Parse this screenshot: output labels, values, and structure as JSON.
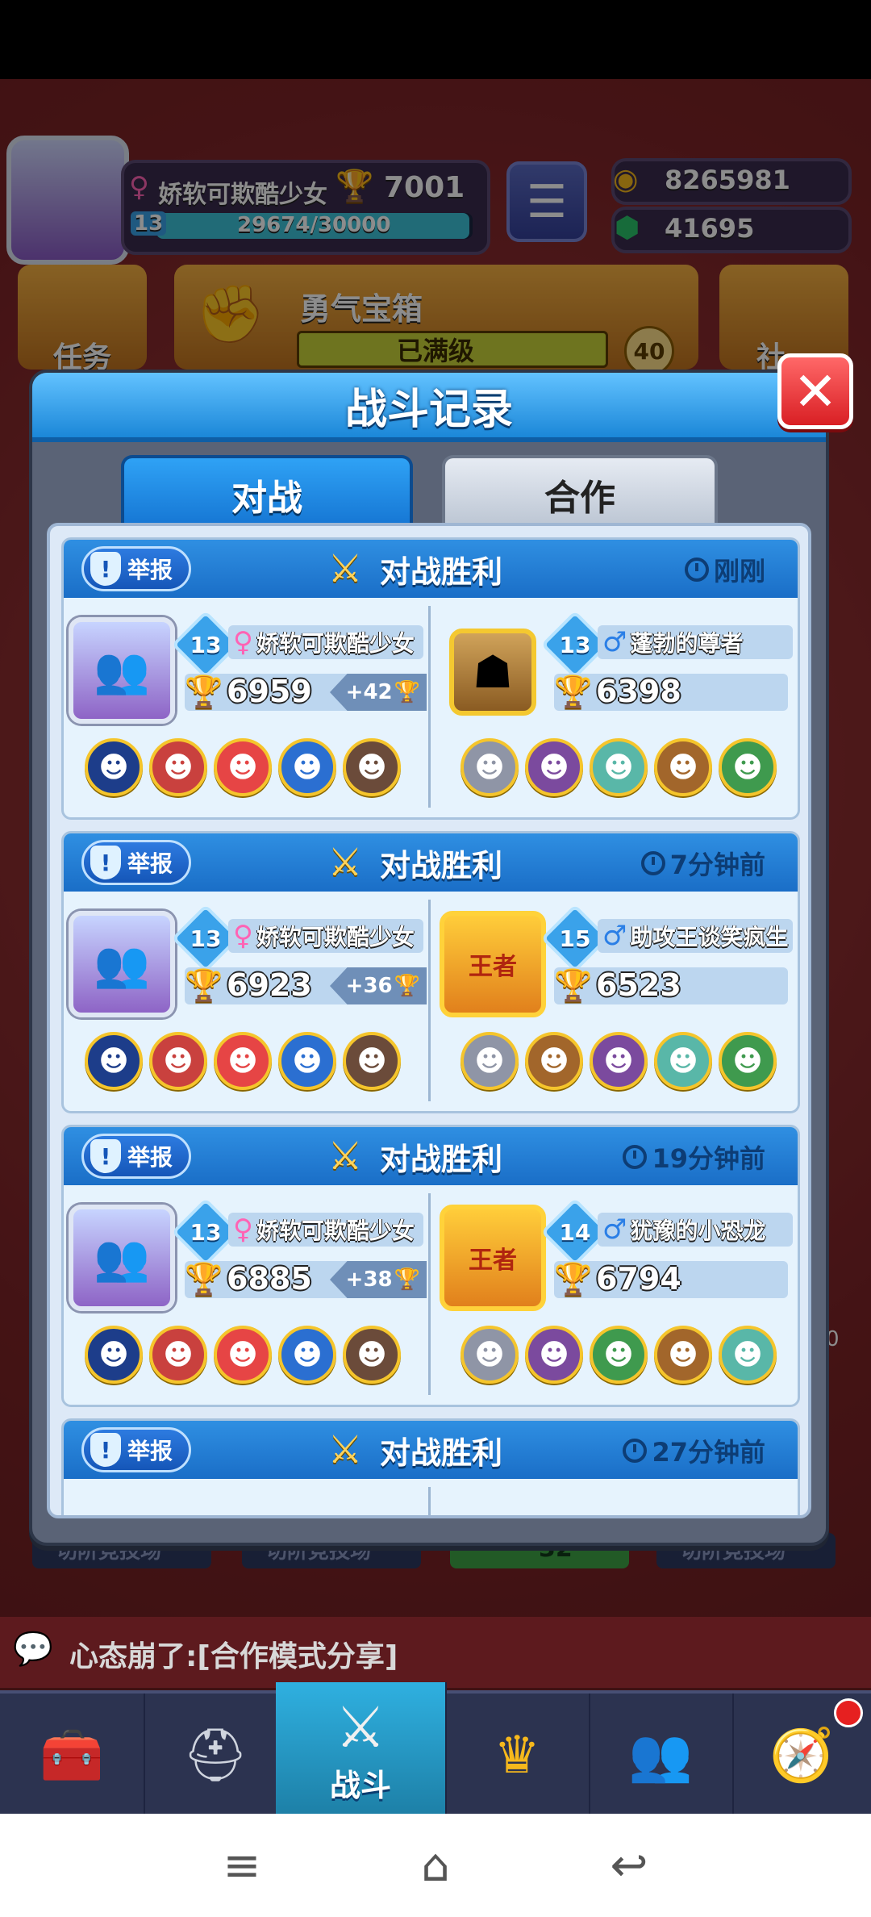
{
  "player": {
    "name": "娇软可欺酷少女",
    "trophies": "7001",
    "level": "13",
    "xp": "29674/30000",
    "gold": "8265981",
    "gems": "41695"
  },
  "home": {
    "task_label": "任务",
    "chest_title": "勇气宝箱",
    "chest_status": "已满级",
    "chest_count": "40",
    "social_label": "社",
    "chat_message": "心态崩了:[合作模式分享]",
    "arena_count": "32",
    "arena_label": "切阶竞技场",
    "side_number": "0"
  },
  "modal": {
    "title": "战斗记录",
    "close_symbol": "✕",
    "tabs": [
      {
        "label": "对战",
        "active": true
      },
      {
        "label": "合作",
        "active": false
      }
    ],
    "report_label": "举报"
  },
  "records": [
    {
      "result": "对战胜利",
      "time": "刚刚",
      "me": {
        "level": "13",
        "name": "娇软可欺酷少女",
        "trophies": "6959",
        "gain": "+42",
        "heroes": [
          "blue-knight-icon",
          "red-bird-icon",
          "clown-icon",
          "pharaoh-icon",
          "maid-girl-icon"
        ]
      },
      "opp": {
        "level": "13",
        "name": "蓬勃的尊者",
        "trophies": "6398",
        "avatar": "wooden-mask-icon",
        "heroes": [
          "silver-knight-icon",
          "purple-girl-icon",
          "mint-creature-icon",
          "bearded-dwarf-icon",
          "green-helmet-icon"
        ]
      }
    },
    {
      "result": "对战胜利",
      "time": "7分钟前",
      "me": {
        "level": "13",
        "name": "娇软可欺酷少女",
        "trophies": "6923",
        "gain": "+36",
        "heroes": [
          "blue-knight-icon",
          "red-bird-icon",
          "clown-icon",
          "pharaoh-icon",
          "maid-girl-icon"
        ]
      },
      "opp": {
        "level": "15",
        "name": "助攻王谈笑疯生",
        "trophies": "6523",
        "avatar": "king-badge-icon",
        "king_label": "王者",
        "heroes": [
          "silver-knight-icon",
          "bearded-dwarf-icon",
          "purple-girl-icon",
          "mint-creature-icon",
          "green-helmet-icon"
        ]
      }
    },
    {
      "result": "对战胜利",
      "time": "19分钟前",
      "me": {
        "level": "13",
        "name": "娇软可欺酷少女",
        "trophies": "6885",
        "gain": "+38",
        "heroes": [
          "blue-knight-icon",
          "red-bird-icon",
          "clown-icon",
          "pharaoh-icon",
          "maid-girl-icon"
        ]
      },
      "opp": {
        "level": "14",
        "name": "犹豫的小恐龙",
        "trophies": "6794",
        "avatar": "king-badge-icon",
        "king_label": "王者",
        "heroes": [
          "silver-knight-icon",
          "purple-girl-icon",
          "green-helmet-icon",
          "bearded-dwarf-icon",
          "mint-creature-icon"
        ]
      }
    },
    {
      "result": "对战胜利",
      "time": "27分钟前"
    }
  ],
  "nav": {
    "battle_label": "战斗",
    "items": [
      "treasure-chest-icon",
      "helmet-icon",
      "battle-swords-icon",
      "crown-laurel-icon",
      "team-icon",
      "compass-icon"
    ]
  },
  "colors": {
    "accent": "#1b87d8",
    "header_blue": "#2f8fe2",
    "trophy_gold": "#f6b81c",
    "close_red": "#d91f24"
  }
}
